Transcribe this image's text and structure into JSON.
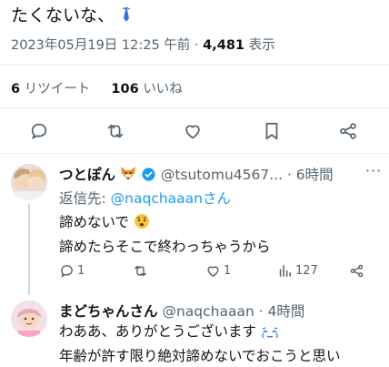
{
  "tweet": {
    "text": "たくないな、",
    "datetime": "2023年05月19日 12:25 午前",
    "views_count": "4,481",
    "views_label": "表示",
    "retweets_count": "6",
    "retweets_label": "リツイート",
    "likes_count": "106",
    "likes_label": "いいね"
  },
  "actions": {
    "reply": "reply-icon",
    "retweet": "retweet-icon",
    "like": "heart-icon",
    "bookmark": "bookmark-icon",
    "share": "share-icon"
  },
  "reply1": {
    "name": "つとぽん",
    "handle": "@tsutomu4567...",
    "time": "· 6時間",
    "reply_to_label": "返信先:",
    "reply_to_handle": "@naqchaaanさん",
    "line1": "諦めないで",
    "line2": "諦めたらそこで終わっちゃうから",
    "reply_count": "1",
    "retweet_count": "",
    "like_count": "1",
    "view_count": "127"
  },
  "reply2": {
    "name": "まどちゃんさん",
    "handle": "@naqchaaan",
    "time": "· 4時間",
    "line1": "わああ、ありがとうございます",
    "line2": "年齢が許す限り絶対諦めないでおこうと思い"
  },
  "colors": {
    "accent": "#1d9bf0",
    "muted": "#536471",
    "divider": "#eff3f4"
  }
}
